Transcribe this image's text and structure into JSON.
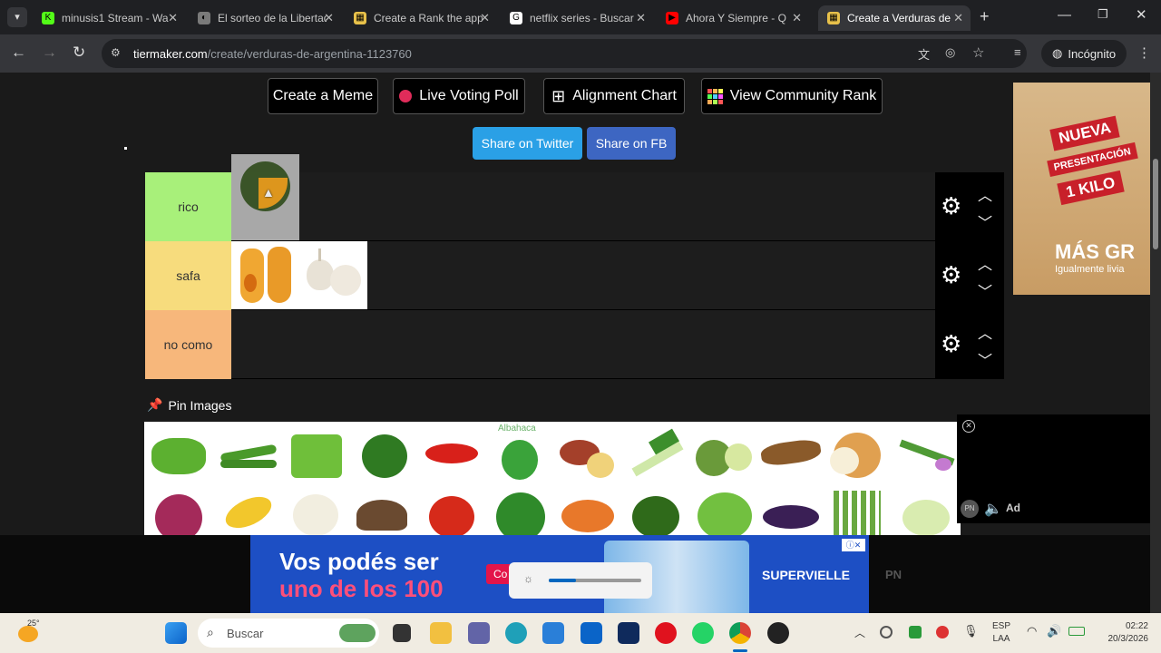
{
  "browser": {
    "tabs": [
      {
        "title": "minusis1 Stream - Wa",
        "color": "#53fc18",
        "glyph": "K"
      },
      {
        "title": "El sorteo de la Libertad",
        "color": "#7a7a7a",
        "glyph": "◐"
      },
      {
        "title": "Create a Rank the app",
        "color": "#e8c14a",
        "glyph": "▦"
      },
      {
        "title": "netflix series - Buscar",
        "color": "#ffffff",
        "glyph": "G"
      },
      {
        "title": "Ahora Y Siempre - Q",
        "color": "#ff0000",
        "glyph": "▶"
      },
      {
        "title": "Create a Verduras de",
        "color": "#e8c14a",
        "glyph": "▦"
      }
    ],
    "url_host": "tiermaker.com",
    "url_path": "/create/verduras-de-argentina-1123760",
    "incognito_label": "Incógnito"
  },
  "toolbar": {
    "create_meme": "Create a Meme",
    "live_voting": "Live Voting Poll",
    "alignment": "Alignment Chart",
    "community": "View Community Rank",
    "share_twitter": "Share on Twitter",
    "share_fb": "Share on FB"
  },
  "tiers": [
    {
      "label": "rico",
      "color": "#a8f07a"
    },
    {
      "label": "safa",
      "color": "#f7dc7d"
    },
    {
      "label": "no como",
      "color": "#f7b77b"
    }
  ],
  "pin_images_label": "Pin Images",
  "pool_caption": "Albahaca",
  "ads": {
    "right_badge_1": "NUEVA",
    "right_badge_2": "PRESENTACIÓN",
    "right_badge_3": "1 KILO",
    "right_text_1": "MÁS GR",
    "right_text_2": "Igualmente livia",
    "video_ad_pn": "PN",
    "video_ad_label": "Ad",
    "banner_line1": "Vos podés ser",
    "banner_line2": "uno de los 100",
    "banner_brand": "SUPERVIELLE",
    "banner_cta": "Co",
    "banner_pn": "PN"
  },
  "taskbar": {
    "weather": "25°",
    "search_placeholder": "Buscar",
    "lang_1": "ESP",
    "lang_2": "LAA",
    "time": "02:22",
    "date": "20/3/2026"
  }
}
